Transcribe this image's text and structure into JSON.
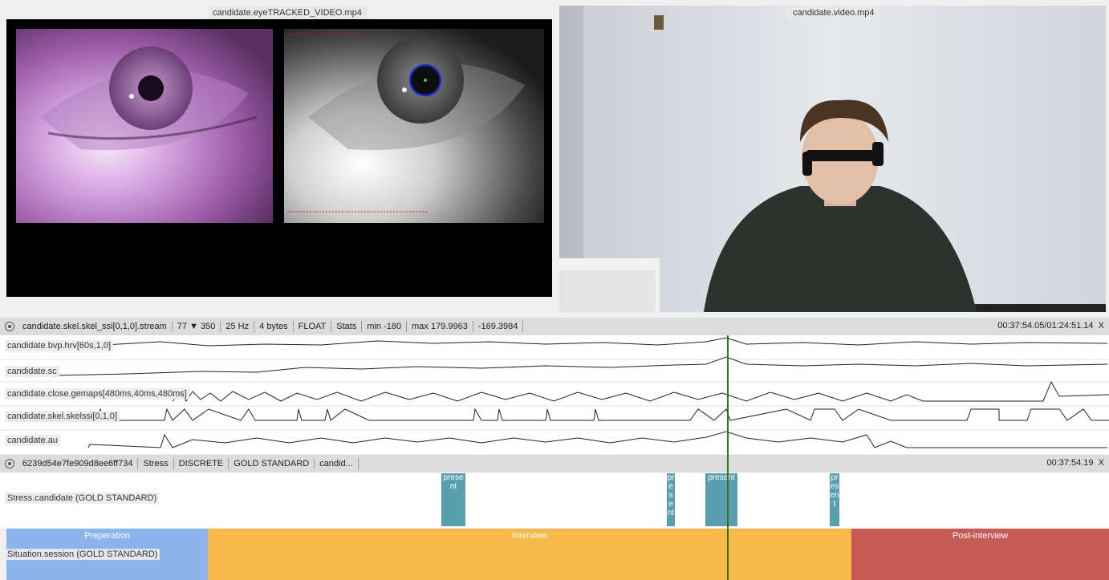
{
  "videos": {
    "left_title": "candidate.eyeTRACKED_VIDEO.mp4",
    "right_title": "candidate.video.mp4"
  },
  "signal_toolbar": {
    "stream": "candidate.skel.skel_ssi[0,1,0].stream",
    "dim": "77",
    "count": "350",
    "rate": "25 Hz",
    "bytes": "4 bytes",
    "type": "FLOAT",
    "stats": "Stats",
    "min": "min -180",
    "max": "max 179.9963",
    "value": "-169.3984",
    "time": "00:37:54.05/01:24:51.14",
    "close": "X"
  },
  "tracks": [
    {
      "label": "candidate.bvp.hrv[60s,1,0]"
    },
    {
      "label": "candidate.sc"
    },
    {
      "label": "candidate.close.gemaps[480ms,40ms,480ms]"
    },
    {
      "label": "candidate.skel.skelssi[0,1,0]"
    },
    {
      "label": "candidate.au"
    }
  ],
  "annotation_toolbar": {
    "id": "6239d54e7fe909d8ee6ff734",
    "scheme": "Stress",
    "kind": "DISCRETE",
    "annotator": "GOLD STANDARD",
    "role": "candid...",
    "time": "00:37:54.19",
    "close": "X"
  },
  "stress_tier": {
    "label": "Stress.candidate (GOLD STANDARD)",
    "marks": [
      "present",
      "present",
      "present",
      "present"
    ]
  },
  "session_tier": {
    "label": "Situation.session (GOLD STANDARD)",
    "segments": [
      {
        "label": "Preperation",
        "color": "#8cb4ec"
      },
      {
        "label": "Interview",
        "color": "#f9b948"
      },
      {
        "label": "Post-interview",
        "color": "#c85a55"
      }
    ]
  },
  "icons": [
    "gear-icon",
    "dropdown-arrow-icon",
    "close-icon"
  ]
}
